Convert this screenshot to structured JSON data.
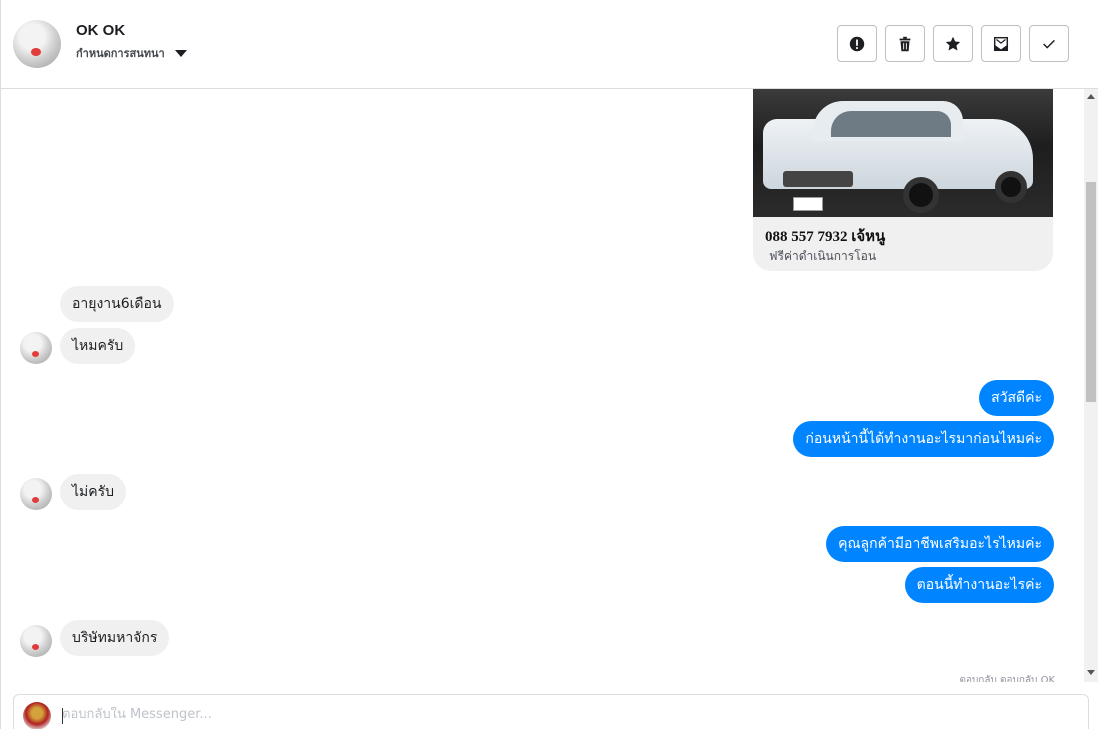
{
  "header": {
    "name": "OK OK",
    "subtitle": "กำหนดการสนทนา",
    "actions": [
      "mark-spam",
      "delete",
      "star",
      "mark-unread",
      "done"
    ]
  },
  "product": {
    "title": "088 557 7932 เจ้หนู",
    "subtitle": "ฟรีค่าดำเนินการโอน"
  },
  "messages": [
    {
      "from": "them",
      "text": "อายุงาน6เดือน"
    },
    {
      "from": "them",
      "text": "ไหมครับ"
    },
    {
      "from": "me",
      "text": "สวัสดีค่ะ"
    },
    {
      "from": "me",
      "text": "ก่อนหน้านี้ได้ทำงานอะไรมาก่อนไหมค่ะ"
    },
    {
      "from": "them",
      "text": "ไม่ครับ"
    },
    {
      "from": "me",
      "text": "คุณลูกค้ามีอาชีพเสริมอะไรไหมค่ะ"
    },
    {
      "from": "me",
      "text": "ตอนนี้ทำงานอะไรค่ะ"
    },
    {
      "from": "them",
      "text": "บริษัทมหาจักร"
    }
  ],
  "seen_note": "ตอบกลับ ตอบกลับ OK",
  "composer": {
    "placeholder": "ตอบกลับใน Messenger..."
  },
  "colors": {
    "outgoing": "#0084ff",
    "incoming": "#f0f0f0"
  }
}
